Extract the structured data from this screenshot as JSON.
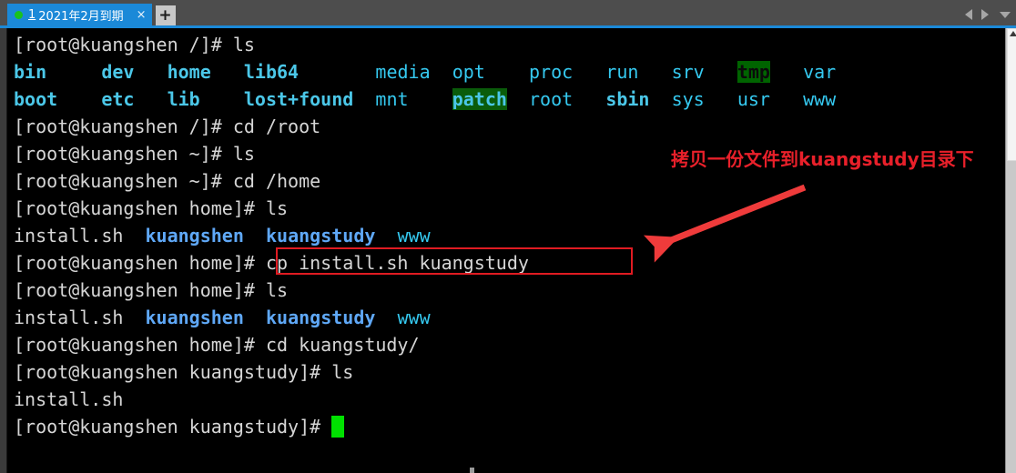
{
  "window": {
    "tabbar": {
      "tabs": [
        {
          "number": "1",
          "title": "2021年2月到期",
          "close_label": "×",
          "status_dot_color": "#19c21e",
          "active": true
        }
      ],
      "new_tab_label": "+",
      "nav_prev_icon": "triangle-left-icon",
      "nav_next_icon": "triangle-right-icon",
      "nav_menu_icon": "chevron-down-icon",
      "background_color": "#4d4d4d",
      "active_tab_color": "#1b89d8"
    },
    "scrollbar": {
      "up_arrow_icon": "scroll-up-arrow-icon",
      "thumb_position_percent": 0,
      "track_color": "#c9c9c9",
      "thumb_color": "#f4f4f4"
    }
  },
  "terminal": {
    "background_color": "#000000",
    "foreground_color": "#d6d6d6",
    "prompt_user": "root",
    "prompt_host": "kuangshen",
    "cursor_color": "#00e000",
    "lines": [
      {
        "id": "line-01",
        "kind": "command",
        "segments": [
          {
            "text": "[root@kuangshen /]# ls",
            "style": "w"
          }
        ]
      },
      {
        "id": "line-02",
        "kind": "output",
        "segments": [
          {
            "text": "bin",
            "style": "cy"
          },
          {
            "text": "     ",
            "style": "w"
          },
          {
            "text": "dev",
            "style": "cy"
          },
          {
            "text": "   ",
            "style": "w"
          },
          {
            "text": "home",
            "style": "cy"
          },
          {
            "text": "   ",
            "style": "w"
          },
          {
            "text": "lib64",
            "style": "cy"
          },
          {
            "text": "       ",
            "style": "w"
          },
          {
            "text": "media",
            "style": "cyd"
          },
          {
            "text": "  ",
            "style": "w"
          },
          {
            "text": "opt",
            "style": "cyd"
          },
          {
            "text": "    ",
            "style": "w"
          },
          {
            "text": "proc",
            "style": "cyd"
          },
          {
            "text": "   ",
            "style": "w"
          },
          {
            "text": "run",
            "style": "cyd"
          },
          {
            "text": "   ",
            "style": "w"
          },
          {
            "text": "srv",
            "style": "cyd"
          },
          {
            "text": "   ",
            "style": "w"
          },
          {
            "text": "tmp",
            "style": "sticky-tmp"
          },
          {
            "text": "   ",
            "style": "w"
          },
          {
            "text": "var",
            "style": "cyd"
          }
        ]
      },
      {
        "id": "line-03",
        "kind": "output",
        "segments": [
          {
            "text": "boot",
            "style": "cy"
          },
          {
            "text": "    ",
            "style": "w"
          },
          {
            "text": "etc",
            "style": "cy"
          },
          {
            "text": "   ",
            "style": "w"
          },
          {
            "text": "lib",
            "style": "cy"
          },
          {
            "text": "    ",
            "style": "w"
          },
          {
            "text": "lost+found",
            "style": "cy"
          },
          {
            "text": "  ",
            "style": "w"
          },
          {
            "text": "mnt",
            "style": "cyd"
          },
          {
            "text": "    ",
            "style": "w"
          },
          {
            "text": "patch",
            "style": "sticky-patch"
          },
          {
            "text": "  ",
            "style": "w"
          },
          {
            "text": "root",
            "style": "cyd"
          },
          {
            "text": "   ",
            "style": "w"
          },
          {
            "text": "sbin",
            "style": "cy"
          },
          {
            "text": "  ",
            "style": "w"
          },
          {
            "text": "sys",
            "style": "cyd"
          },
          {
            "text": "   ",
            "style": "w"
          },
          {
            "text": "usr",
            "style": "cyd"
          },
          {
            "text": "   ",
            "style": "w"
          },
          {
            "text": "www",
            "style": "cyd"
          }
        ]
      },
      {
        "id": "line-04",
        "kind": "command",
        "segments": [
          {
            "text": "[root@kuangshen /]# cd /root",
            "style": "w"
          }
        ]
      },
      {
        "id": "line-05",
        "kind": "command",
        "segments": [
          {
            "text": "[root@kuangshen ~]# ls",
            "style": "w"
          }
        ]
      },
      {
        "id": "line-06",
        "kind": "command",
        "segments": [
          {
            "text": "[root@kuangshen ~]# cd /home",
            "style": "w"
          }
        ]
      },
      {
        "id": "line-07",
        "kind": "command",
        "segments": [
          {
            "text": "[root@kuangshen home]# ls",
            "style": "w"
          }
        ]
      },
      {
        "id": "line-08",
        "kind": "output",
        "segments": [
          {
            "text": "install.sh",
            "style": "w"
          },
          {
            "text": "  ",
            "style": "w"
          },
          {
            "text": "kuangshen",
            "style": "dir"
          },
          {
            "text": "  ",
            "style": "w"
          },
          {
            "text": "kuangstudy",
            "style": "dir"
          },
          {
            "text": "  ",
            "style": "w"
          },
          {
            "text": "www",
            "style": "cyd"
          }
        ]
      },
      {
        "id": "line-09",
        "kind": "command",
        "highlighted": true,
        "segments": [
          {
            "text": "[root@kuangshen home]# cp install.sh kuangstudy",
            "style": "w"
          }
        ]
      },
      {
        "id": "line-10",
        "kind": "command",
        "segments": [
          {
            "text": "[root@kuangshen home]# ls",
            "style": "w"
          }
        ]
      },
      {
        "id": "line-11",
        "kind": "output",
        "segments": [
          {
            "text": "install.sh",
            "style": "w"
          },
          {
            "text": "  ",
            "style": "w"
          },
          {
            "text": "kuangshen",
            "style": "dir"
          },
          {
            "text": "  ",
            "style": "w"
          },
          {
            "text": "kuangstudy",
            "style": "dir"
          },
          {
            "text": "  ",
            "style": "w"
          },
          {
            "text": "www",
            "style": "cyd"
          }
        ]
      },
      {
        "id": "line-12",
        "kind": "command",
        "segments": [
          {
            "text": "[root@kuangshen home]# cd kuangstudy/",
            "style": "w"
          }
        ]
      },
      {
        "id": "line-13",
        "kind": "command",
        "segments": [
          {
            "text": "[root@kuangshen kuangstudy]# ls",
            "style": "w"
          }
        ]
      },
      {
        "id": "line-14",
        "kind": "output",
        "segments": [
          {
            "text": "install.sh",
            "style": "w"
          }
        ]
      },
      {
        "id": "line-15",
        "kind": "prompt",
        "cursor": true,
        "segments": [
          {
            "text": "[root@kuangshen kuangstudy]# ",
            "style": "w"
          }
        ]
      }
    ]
  },
  "annotation": {
    "note_text": "拷贝一份文件到kuangstudy目录下",
    "note_color": "#e8202a",
    "arrow_color": "#ef3b3b",
    "highlight_box_color": "#e01b22"
  }
}
